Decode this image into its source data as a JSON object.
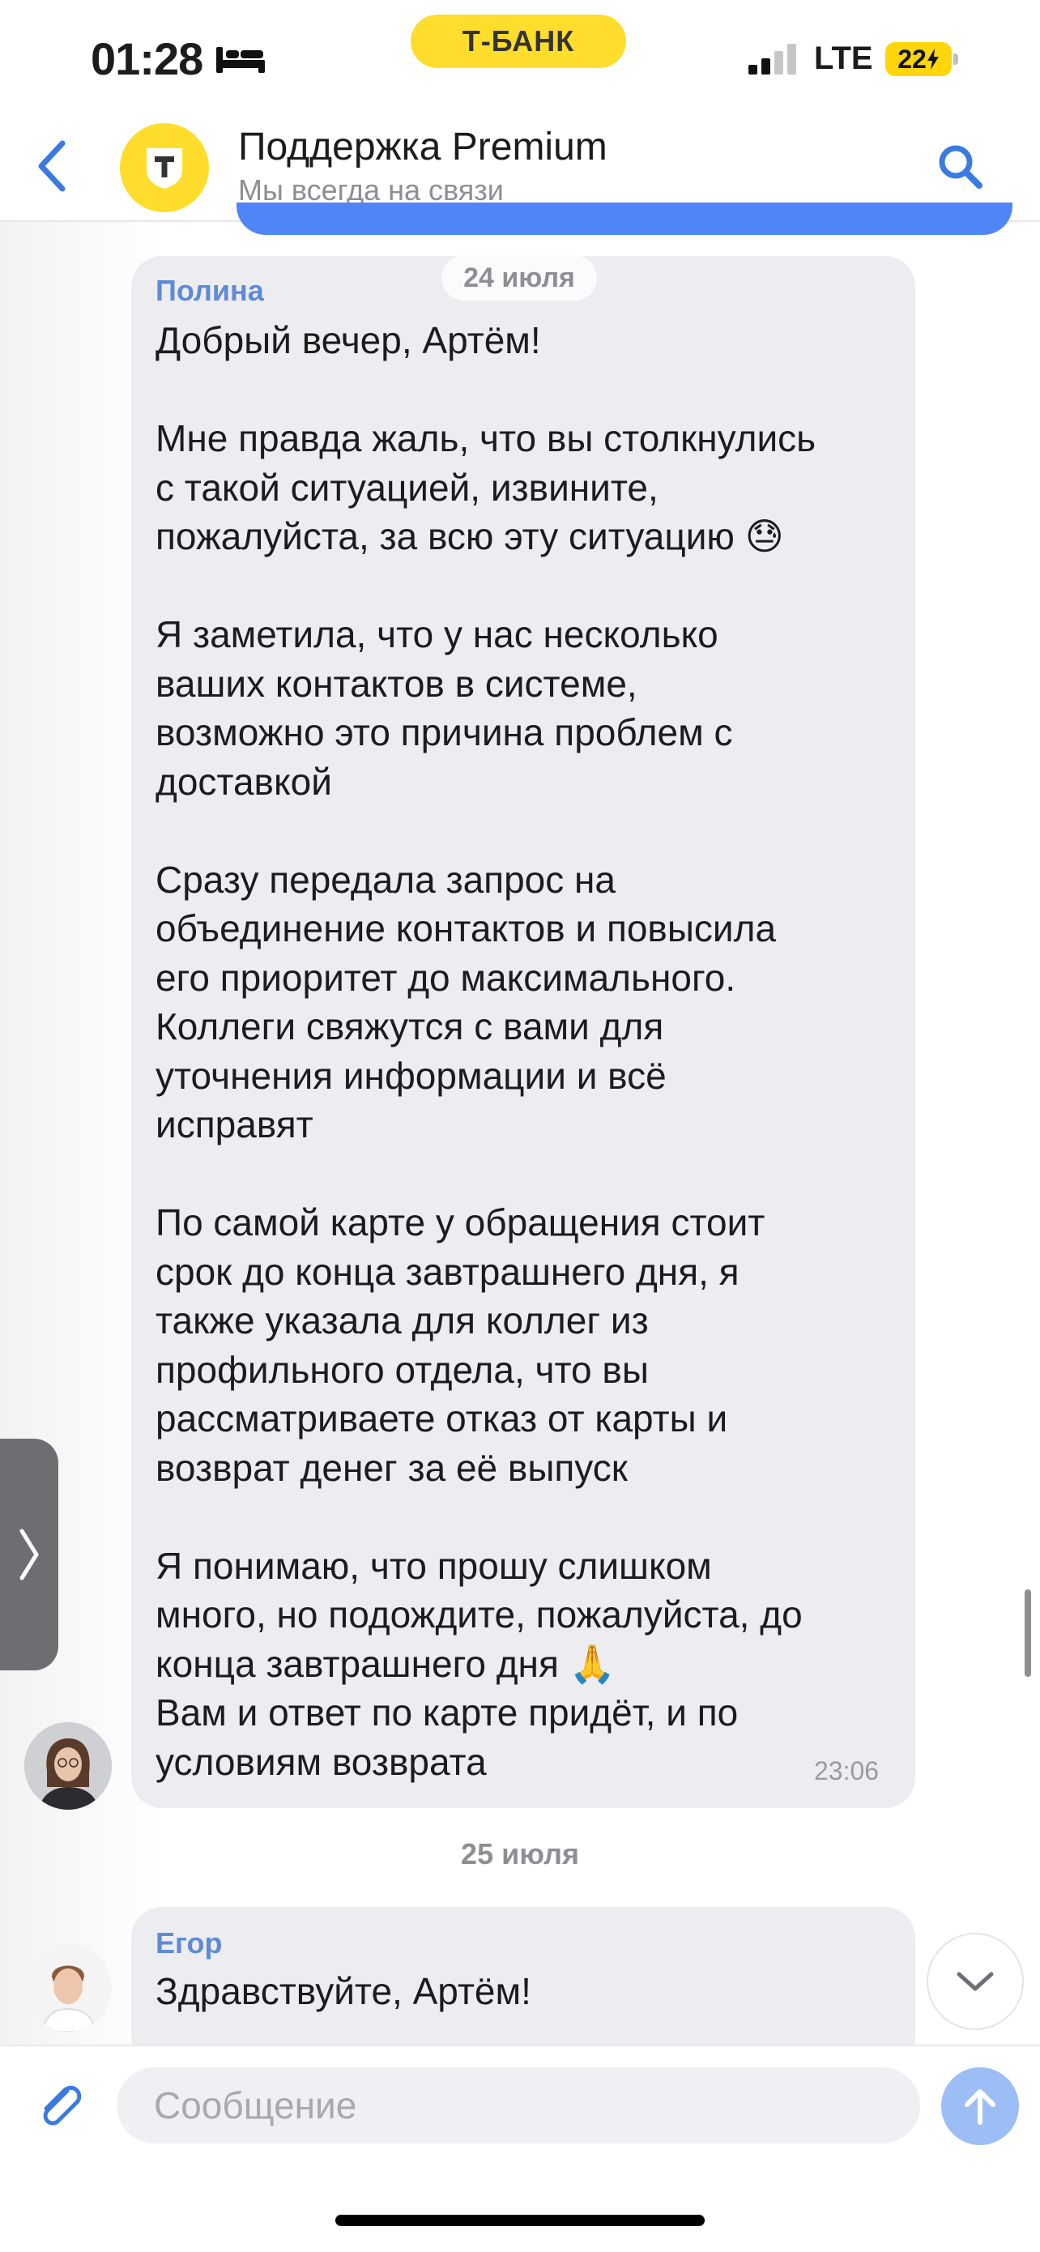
{
  "status_bar": {
    "time": "01:28",
    "bank_label": "Т-БАНК",
    "network": "LTE",
    "battery": "22"
  },
  "header": {
    "title": "Поддержка Premium",
    "subtitle": "Мы всегда на связи",
    "back_icon": "chevron-left-icon",
    "search_icon": "search-icon",
    "avatar_letter": "Т"
  },
  "messages": [
    {
      "date": "24 июля",
      "sender": "Полина",
      "text": "Добрый вечер, Артём!\n\nМне правда жаль, что вы столкнулись\nс такой ситуацией, извините,\nпожалуйста, за всю эту ситуацию 😓\n\nЯ заметила, что у нас несколько\nваших контактов в системе,\nвозможно это причина проблем с\nдоставкой\n\nСразу передала запрос на\nобъединение контактов и повысила\nего приоритет до максимального.\nКоллеги свяжутся с вами для\nуточнения информации и всё\nисправят\n\nПо самой карте у обращения стоит\nсрок до конца завтрашнего дня, я\nтакже указала для коллег из\nпрофильного отдела, что вы\nрассматриваете отказ от карты и\nвозврат денег за её выпуск\n\nЯ понимаю, что прошу слишком\nмного, но подождите, пожалуйста, до\nконца завтрашнего дня 🙏\nВам и ответ по карте придёт, и по\nусловиям возврата",
      "time": "23:06"
    },
    {
      "date": "25 июля",
      "sender": "Егор",
      "text": "Здравствуйте, Артём!"
    }
  ],
  "composer": {
    "placeholder": "Сообщение"
  },
  "colors": {
    "brand_yellow": "#ffdd2d",
    "accent_blue": "#4f86f7",
    "bubble_gray": "#ededf1",
    "sender_blue": "#5f8ad6",
    "send_button": "#9dbdf6"
  }
}
